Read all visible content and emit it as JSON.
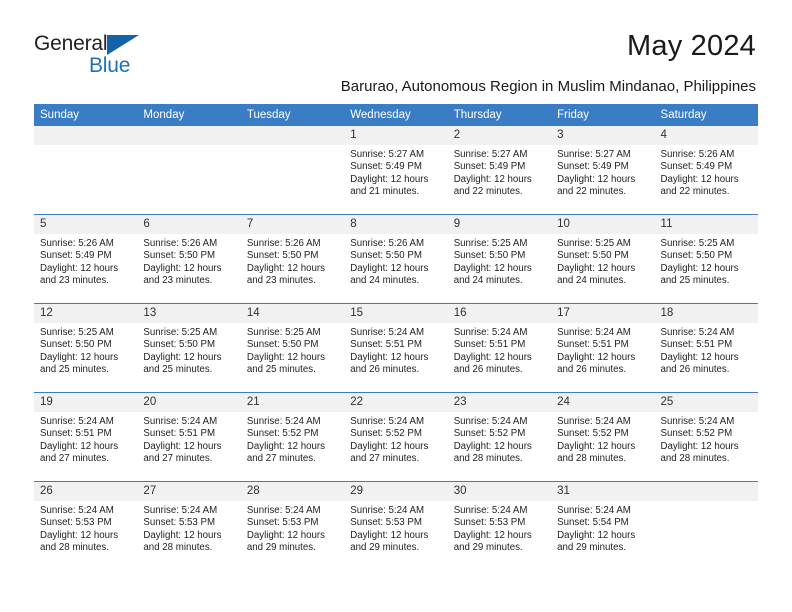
{
  "brand": {
    "name_top": "General",
    "name_bottom": "Blue",
    "accent_color": "#1263a8",
    "text_color": "#222222"
  },
  "header": {
    "month_title": "May 2024",
    "location": "Barurao, Autonomous Region in Muslim Mindanao, Philippines"
  },
  "calendar": {
    "header_bg": "#3a7dc4",
    "daynum_bg": "#f1f1f1",
    "weekday_headers": [
      "Sunday",
      "Monday",
      "Tuesday",
      "Wednesday",
      "Thursday",
      "Friday",
      "Saturday"
    ],
    "weeks": [
      [
        {
          "date": "",
          "empty": true,
          "sunrise": "",
          "sunset": "",
          "daylight_line1": "",
          "daylight_line2": ""
        },
        {
          "date": "",
          "empty": true,
          "sunrise": "",
          "sunset": "",
          "daylight_line1": "",
          "daylight_line2": ""
        },
        {
          "date": "",
          "empty": true,
          "sunrise": "",
          "sunset": "",
          "daylight_line1": "",
          "daylight_line2": ""
        },
        {
          "date": "1",
          "empty": false,
          "sunrise": "Sunrise: 5:27 AM",
          "sunset": "Sunset: 5:49 PM",
          "daylight_line1": "Daylight: 12 hours",
          "daylight_line2": "and 21 minutes."
        },
        {
          "date": "2",
          "empty": false,
          "sunrise": "Sunrise: 5:27 AM",
          "sunset": "Sunset: 5:49 PM",
          "daylight_line1": "Daylight: 12 hours",
          "daylight_line2": "and 22 minutes."
        },
        {
          "date": "3",
          "empty": false,
          "sunrise": "Sunrise: 5:27 AM",
          "sunset": "Sunset: 5:49 PM",
          "daylight_line1": "Daylight: 12 hours",
          "daylight_line2": "and 22 minutes."
        },
        {
          "date": "4",
          "empty": false,
          "sunrise": "Sunrise: 5:26 AM",
          "sunset": "Sunset: 5:49 PM",
          "daylight_line1": "Daylight: 12 hours",
          "daylight_line2": "and 22 minutes."
        }
      ],
      [
        {
          "date": "5",
          "empty": false,
          "sunrise": "Sunrise: 5:26 AM",
          "sunset": "Sunset: 5:49 PM",
          "daylight_line1": "Daylight: 12 hours",
          "daylight_line2": "and 23 minutes."
        },
        {
          "date": "6",
          "empty": false,
          "sunrise": "Sunrise: 5:26 AM",
          "sunset": "Sunset: 5:50 PM",
          "daylight_line1": "Daylight: 12 hours",
          "daylight_line2": "and 23 minutes."
        },
        {
          "date": "7",
          "empty": false,
          "sunrise": "Sunrise: 5:26 AM",
          "sunset": "Sunset: 5:50 PM",
          "daylight_line1": "Daylight: 12 hours",
          "daylight_line2": "and 23 minutes."
        },
        {
          "date": "8",
          "empty": false,
          "sunrise": "Sunrise: 5:26 AM",
          "sunset": "Sunset: 5:50 PM",
          "daylight_line1": "Daylight: 12 hours",
          "daylight_line2": "and 24 minutes."
        },
        {
          "date": "9",
          "empty": false,
          "sunrise": "Sunrise: 5:25 AM",
          "sunset": "Sunset: 5:50 PM",
          "daylight_line1": "Daylight: 12 hours",
          "daylight_line2": "and 24 minutes."
        },
        {
          "date": "10",
          "empty": false,
          "sunrise": "Sunrise: 5:25 AM",
          "sunset": "Sunset: 5:50 PM",
          "daylight_line1": "Daylight: 12 hours",
          "daylight_line2": "and 24 minutes."
        },
        {
          "date": "11",
          "empty": false,
          "sunrise": "Sunrise: 5:25 AM",
          "sunset": "Sunset: 5:50 PM",
          "daylight_line1": "Daylight: 12 hours",
          "daylight_line2": "and 25 minutes."
        }
      ],
      [
        {
          "date": "12",
          "empty": false,
          "sunrise": "Sunrise: 5:25 AM",
          "sunset": "Sunset: 5:50 PM",
          "daylight_line1": "Daylight: 12 hours",
          "daylight_line2": "and 25 minutes."
        },
        {
          "date": "13",
          "empty": false,
          "sunrise": "Sunrise: 5:25 AM",
          "sunset": "Sunset: 5:50 PM",
          "daylight_line1": "Daylight: 12 hours",
          "daylight_line2": "and 25 minutes."
        },
        {
          "date": "14",
          "empty": false,
          "sunrise": "Sunrise: 5:25 AM",
          "sunset": "Sunset: 5:50 PM",
          "daylight_line1": "Daylight: 12 hours",
          "daylight_line2": "and 25 minutes."
        },
        {
          "date": "15",
          "empty": false,
          "sunrise": "Sunrise: 5:24 AM",
          "sunset": "Sunset: 5:51 PM",
          "daylight_line1": "Daylight: 12 hours",
          "daylight_line2": "and 26 minutes."
        },
        {
          "date": "16",
          "empty": false,
          "sunrise": "Sunrise: 5:24 AM",
          "sunset": "Sunset: 5:51 PM",
          "daylight_line1": "Daylight: 12 hours",
          "daylight_line2": "and 26 minutes."
        },
        {
          "date": "17",
          "empty": false,
          "sunrise": "Sunrise: 5:24 AM",
          "sunset": "Sunset: 5:51 PM",
          "daylight_line1": "Daylight: 12 hours",
          "daylight_line2": "and 26 minutes."
        },
        {
          "date": "18",
          "empty": false,
          "sunrise": "Sunrise: 5:24 AM",
          "sunset": "Sunset: 5:51 PM",
          "daylight_line1": "Daylight: 12 hours",
          "daylight_line2": "and 26 minutes."
        }
      ],
      [
        {
          "date": "19",
          "empty": false,
          "sunrise": "Sunrise: 5:24 AM",
          "sunset": "Sunset: 5:51 PM",
          "daylight_line1": "Daylight: 12 hours",
          "daylight_line2": "and 27 minutes."
        },
        {
          "date": "20",
          "empty": false,
          "sunrise": "Sunrise: 5:24 AM",
          "sunset": "Sunset: 5:51 PM",
          "daylight_line1": "Daylight: 12 hours",
          "daylight_line2": "and 27 minutes."
        },
        {
          "date": "21",
          "empty": false,
          "sunrise": "Sunrise: 5:24 AM",
          "sunset": "Sunset: 5:52 PM",
          "daylight_line1": "Daylight: 12 hours",
          "daylight_line2": "and 27 minutes."
        },
        {
          "date": "22",
          "empty": false,
          "sunrise": "Sunrise: 5:24 AM",
          "sunset": "Sunset: 5:52 PM",
          "daylight_line1": "Daylight: 12 hours",
          "daylight_line2": "and 27 minutes."
        },
        {
          "date": "23",
          "empty": false,
          "sunrise": "Sunrise: 5:24 AM",
          "sunset": "Sunset: 5:52 PM",
          "daylight_line1": "Daylight: 12 hours",
          "daylight_line2": "and 28 minutes."
        },
        {
          "date": "24",
          "empty": false,
          "sunrise": "Sunrise: 5:24 AM",
          "sunset": "Sunset: 5:52 PM",
          "daylight_line1": "Daylight: 12 hours",
          "daylight_line2": "and 28 minutes."
        },
        {
          "date": "25",
          "empty": false,
          "sunrise": "Sunrise: 5:24 AM",
          "sunset": "Sunset: 5:52 PM",
          "daylight_line1": "Daylight: 12 hours",
          "daylight_line2": "and 28 minutes."
        }
      ],
      [
        {
          "date": "26",
          "empty": false,
          "sunrise": "Sunrise: 5:24 AM",
          "sunset": "Sunset: 5:53 PM",
          "daylight_line1": "Daylight: 12 hours",
          "daylight_line2": "and 28 minutes."
        },
        {
          "date": "27",
          "empty": false,
          "sunrise": "Sunrise: 5:24 AM",
          "sunset": "Sunset: 5:53 PM",
          "daylight_line1": "Daylight: 12 hours",
          "daylight_line2": "and 28 minutes."
        },
        {
          "date": "28",
          "empty": false,
          "sunrise": "Sunrise: 5:24 AM",
          "sunset": "Sunset: 5:53 PM",
          "daylight_line1": "Daylight: 12 hours",
          "daylight_line2": "and 29 minutes."
        },
        {
          "date": "29",
          "empty": false,
          "sunrise": "Sunrise: 5:24 AM",
          "sunset": "Sunset: 5:53 PM",
          "daylight_line1": "Daylight: 12 hours",
          "daylight_line2": "and 29 minutes."
        },
        {
          "date": "30",
          "empty": false,
          "sunrise": "Sunrise: 5:24 AM",
          "sunset": "Sunset: 5:53 PM",
          "daylight_line1": "Daylight: 12 hours",
          "daylight_line2": "and 29 minutes."
        },
        {
          "date": "31",
          "empty": false,
          "sunrise": "Sunrise: 5:24 AM",
          "sunset": "Sunset: 5:54 PM",
          "daylight_line1": "Daylight: 12 hours",
          "daylight_line2": "and 29 minutes."
        },
        {
          "date": "",
          "empty": true,
          "sunrise": "",
          "sunset": "",
          "daylight_line1": "",
          "daylight_line2": ""
        }
      ]
    ]
  }
}
